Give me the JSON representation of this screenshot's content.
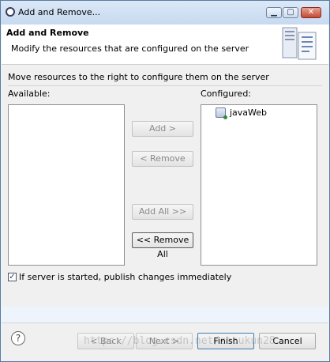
{
  "window": {
    "title": "Add and Remove..."
  },
  "header": {
    "title": "Add and Remove",
    "description": "Modify the resources that are configured on the server",
    "icon": "server-config-icon"
  },
  "main": {
    "instructions": "Move resources to the right to configure them on the server",
    "available_label": "Available:",
    "configured_label": "Configured:",
    "available_items": [],
    "configured_items": [
      {
        "label": "javaWeb",
        "icon": "web-project-icon"
      }
    ],
    "buttons": {
      "add": "Add >",
      "remove": "< Remove",
      "add_all": "Add All >>",
      "remove_all": "<< Remove All"
    },
    "publish_checkbox": {
      "label": "If server is started, publish changes immediately",
      "checked": true
    }
  },
  "footer": {
    "help": "?",
    "back": "< Back",
    "next": "Next >",
    "finish": "Finish",
    "cancel": "Cancel"
  },
  "watermark": "https://blog.csdn.net/zhoukun28",
  "colors": {
    "titlebar": "#c7daf0",
    "header_bg": "#ffffff",
    "body_bg": "#f0f0f0",
    "close_button": "#c24a35"
  }
}
